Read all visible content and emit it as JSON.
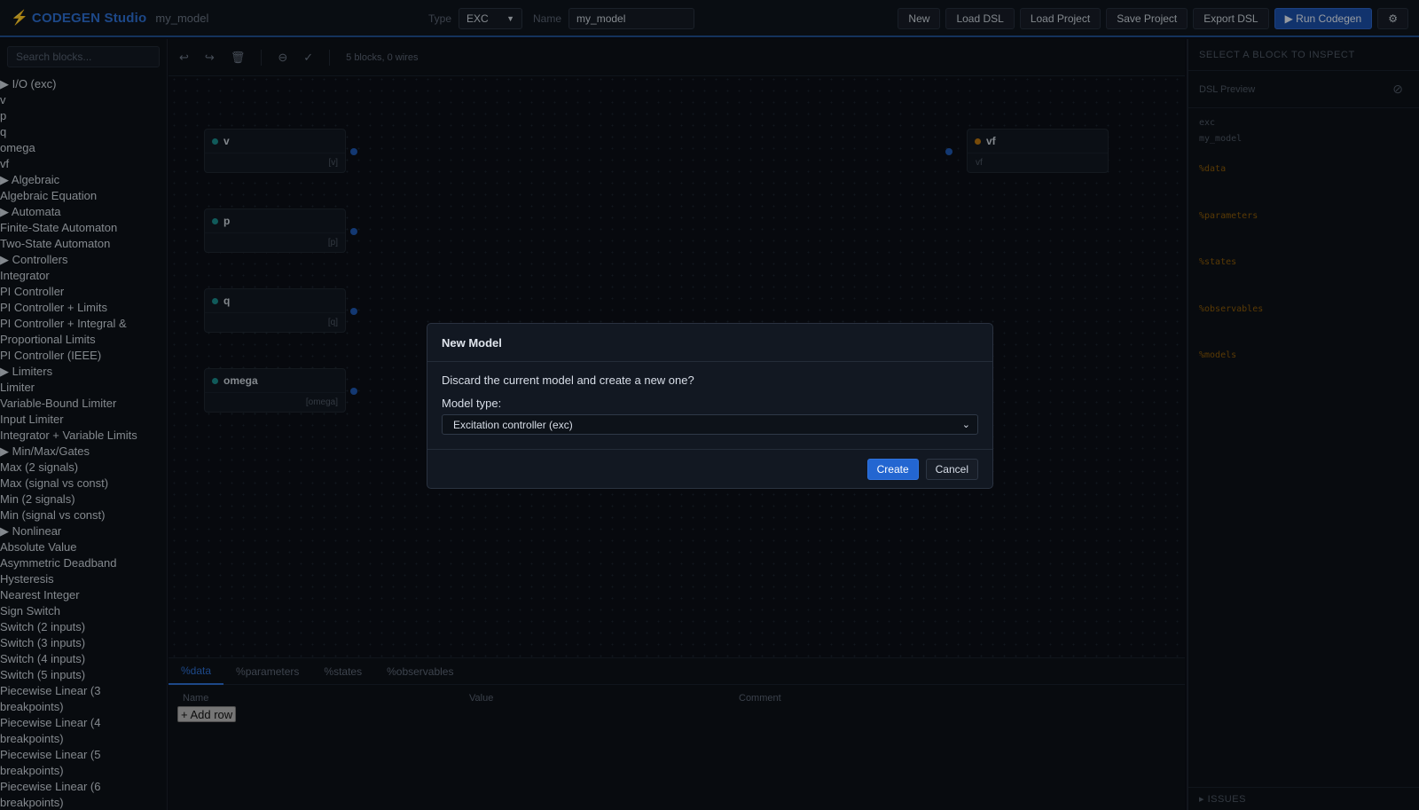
{
  "header": {
    "brand": "CODEGEN Studio",
    "model_name": "my_model",
    "type_label": "Type",
    "type_value": "EXC",
    "name_label": "Name",
    "name_value": "my_model",
    "actions": [
      "New",
      "Load DSL",
      "Load Project",
      "Save Project",
      "Export DSL",
      "▶ Run Codegen",
      "⚙"
    ]
  },
  "sidebar": {
    "search_placeholder": "Search blocks...",
    "groups": [
      {
        "label": "▶ I/O (exc)",
        "items": [
          "v",
          "p",
          "q",
          "omega",
          "vf"
        ]
      },
      {
        "label": "▶ Algebraic",
        "items": [
          "Algebraic Equation"
        ]
      },
      {
        "label": "▶ Automata",
        "items": [
          "Finite-State Automaton",
          "Two-State Automaton"
        ]
      },
      {
        "label": "▶ Controllers",
        "items": [
          "Integrator",
          "PI Controller",
          "PI Controller + Limits",
          "PI Controller + Integral & Proportional Limits",
          "PI Controller (IEEE)"
        ]
      },
      {
        "label": "▶ Limiters",
        "items": [
          "Limiter",
          "Variable-Bound Limiter",
          "Input Limiter",
          "Integrator + Variable Limits"
        ]
      },
      {
        "label": "▶ Min/Max/Gates",
        "items": [
          "Max (2 signals)",
          "Max (signal vs const)",
          "Min (2 signals)",
          "Min (signal vs const)"
        ]
      },
      {
        "label": "▶ Nonlinear",
        "items": [
          "Absolute Value",
          "Asymmetric Deadband",
          "Hysteresis",
          "Nearest Integer",
          "Sign Switch",
          "Switch (2 inputs)",
          "Switch (3 inputs)",
          "Switch (4 inputs)",
          "Switch (5 inputs)",
          "Piecewise Linear (3 breakpoints)",
          "Piecewise Linear (4 breakpoints)",
          "Piecewise Linear (5 breakpoints)",
          "Piecewise Linear (6 breakpoints)"
        ]
      }
    ]
  },
  "canvas": {
    "toolbar_icons": [
      "↩",
      "↪",
      "🗑",
      "⊖",
      "✓"
    ],
    "info": "5 blocks, 0 wires",
    "nodes": [
      {
        "title": "v",
        "foot": "[v]"
      },
      {
        "title": "p",
        "foot": "[p]"
      },
      {
        "title": "q",
        "foot": "[q]"
      },
      {
        "title": "omega",
        "foot": "[omega]"
      },
      {
        "title": "vf",
        "foot": "vf"
      }
    ]
  },
  "bottom": {
    "tabs": [
      "%data",
      "%parameters",
      "%states",
      "%observables"
    ],
    "columns": [
      "Name",
      "Value",
      "Comment"
    ],
    "add_row": "+ Add row"
  },
  "inspector": {
    "header": "SELECT A BLOCK TO INSPECT",
    "dsl_title": "DSL Preview",
    "dsl_lines": [
      "exc",
      "my_model"
    ],
    "dsl_sections": [
      "%data",
      "%parameters",
      "%states",
      "%observables",
      "%models"
    ],
    "issues": "▸ ISSUES"
  },
  "modal": {
    "title": "New Model",
    "question": "Discard the current model and create a new one?",
    "type_label": "Model type:",
    "type_value": "Excitation controller (exc)",
    "create": "Create",
    "cancel": "Cancel"
  },
  "colors": {
    "accent": "#2d6fd1",
    "brand_bolt": "#e3a21a",
    "dsl_section": "#8a5a08"
  }
}
